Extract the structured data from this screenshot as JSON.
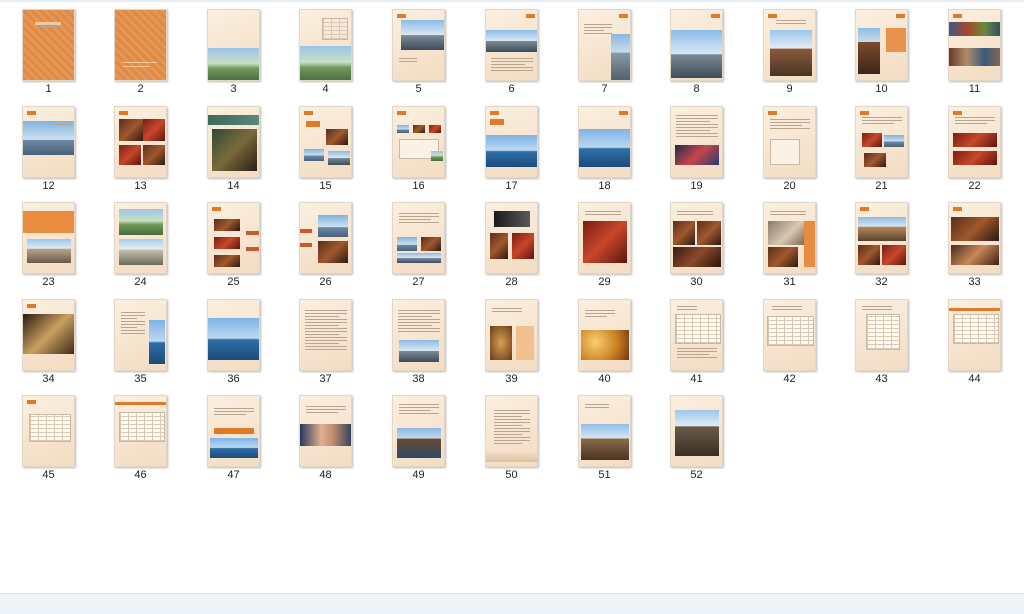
{
  "colors": {
    "page": "#f6e6d2",
    "accent": "#e07a2a",
    "cover": "#e38d4a"
  },
  "pages": [
    {
      "number": "1",
      "style": "cover"
    },
    {
      "number": "2",
      "style": "cover2"
    },
    {
      "number": "3",
      "style": "aerial"
    },
    {
      "number": "4",
      "style": "aerial-chart"
    },
    {
      "number": "5",
      "style": "city-top"
    },
    {
      "number": "6",
      "style": "city-top-text"
    },
    {
      "number": "7",
      "style": "tower-right"
    },
    {
      "number": "8",
      "style": "city-full"
    },
    {
      "number": "9",
      "style": "street-photo"
    },
    {
      "number": "10",
      "style": "building-left"
    },
    {
      "number": "11",
      "style": "collage"
    },
    {
      "number": "12",
      "style": "bridge"
    },
    {
      "number": "13",
      "style": "interior-grid"
    },
    {
      "number": "14",
      "style": "interior-big"
    },
    {
      "number": "15",
      "style": "text-photos"
    },
    {
      "number": "16",
      "style": "map"
    },
    {
      "number": "17",
      "style": "circles"
    },
    {
      "number": "18",
      "style": "circles2"
    },
    {
      "number": "19",
      "style": "text-bottom-photo"
    },
    {
      "number": "20",
      "style": "map-text"
    },
    {
      "number": "21",
      "style": "text-photos-right"
    },
    {
      "number": "22",
      "style": "red-crowd"
    },
    {
      "number": "23",
      "style": "orange-block"
    },
    {
      "number": "24",
      "style": "houses"
    },
    {
      "number": "25",
      "style": "side-tabs"
    },
    {
      "number": "26",
      "style": "side-tabs-photos"
    },
    {
      "number": "27",
      "style": "text-photo-mid"
    },
    {
      "number": "28",
      "style": "dark-photos"
    },
    {
      "number": "29",
      "style": "red-interior"
    },
    {
      "number": "30",
      "style": "dark-interior"
    },
    {
      "number": "31",
      "style": "lobby"
    },
    {
      "number": "32",
      "style": "villa"
    },
    {
      "number": "33",
      "style": "restaurant"
    },
    {
      "number": "34",
      "style": "hall"
    },
    {
      "number": "35",
      "style": "text-tall-photo"
    },
    {
      "number": "36",
      "style": "harbor"
    },
    {
      "number": "37",
      "style": "text-only"
    },
    {
      "number": "38",
      "style": "text-photo-low"
    },
    {
      "number": "39",
      "style": "painting"
    },
    {
      "number": "40",
      "style": "coins"
    },
    {
      "number": "41",
      "style": "table"
    },
    {
      "number": "42",
      "style": "table2"
    },
    {
      "number": "43",
      "style": "table3"
    },
    {
      "number": "44",
      "style": "table4"
    },
    {
      "number": "45",
      "style": "table5"
    },
    {
      "number": "46",
      "style": "table6"
    },
    {
      "number": "47",
      "style": "title-sea"
    },
    {
      "number": "48",
      "style": "handshake"
    },
    {
      "number": "49",
      "style": "canal"
    },
    {
      "number": "50",
      "style": "text-faded"
    },
    {
      "number": "51",
      "style": "old-town"
    },
    {
      "number": "52",
      "style": "old-town2"
    }
  ]
}
